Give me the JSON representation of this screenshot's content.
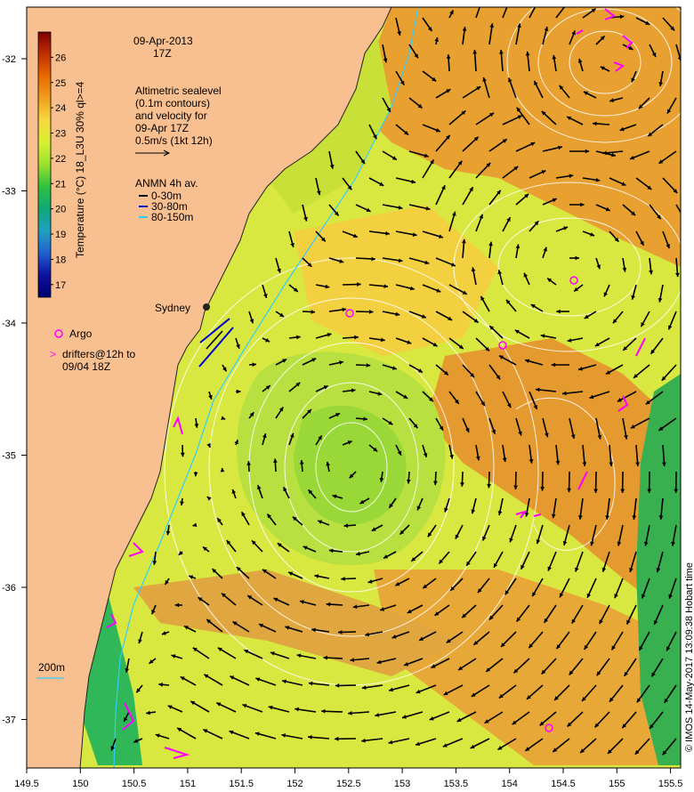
{
  "title": {
    "date": "09-Apr-2013",
    "time": "17Z"
  },
  "altimetry_note": {
    "lines": [
      "Altimetric sealevel",
      "(0.1m contours)",
      "and velocity for",
      "09-Apr 17Z",
      "0.5m/s (1kt 12h)"
    ]
  },
  "anmn_legend": {
    "title": "ANMN 4h av.",
    "items": [
      {
        "label": "0-30m",
        "color": "#000000"
      },
      {
        "label": "30-80m",
        "color": "#0000cc"
      },
      {
        "label": "80-150m",
        "color": "#33ccff"
      }
    ]
  },
  "city": {
    "label": "Sydney"
  },
  "argo": {
    "label": "Argo",
    "color": "#ff00ff"
  },
  "drifters": {
    "symbol": ">",
    "lines": [
      "drifters@12h to",
      "09/04 18Z"
    ],
    "color": "#ff00ff"
  },
  "isobath": {
    "label": "200m",
    "color": "#33ccff"
  },
  "colorbar": {
    "label": "Temperature (°C) 18_L3U 30% ql>=4",
    "ticks": [
      "26",
      "25",
      "24",
      "23",
      "22",
      "21",
      "20",
      "19",
      "18",
      "17"
    ],
    "range": [
      16.5,
      27
    ],
    "colors": [
      "#7a0000",
      "#c03000",
      "#e86a00",
      "#f0a020",
      "#f7d840",
      "#d8f030",
      "#9ae030",
      "#30c040",
      "#10a878",
      "#20a0c0",
      "#2060d0",
      "#1010a0",
      "#000070"
    ]
  },
  "axes": {
    "x_ticks": [
      "149.5",
      "150",
      "150.5",
      "151",
      "151.5",
      "152",
      "152.5",
      "153",
      "153.5",
      "154",
      "154.5",
      "155",
      "155.5"
    ],
    "y_ticks": [
      "-32",
      "-33",
      "-34",
      "-35",
      "-36",
      "-37"
    ]
  },
  "credit": "© IMOS 14-May-2017 13:09:38 Hobart time",
  "colors": {
    "land": "#f8c090",
    "warm": "#e59a30",
    "mid": "#f3d040",
    "cool": "#b8e040",
    "shelf_green": "#30b858"
  }
}
